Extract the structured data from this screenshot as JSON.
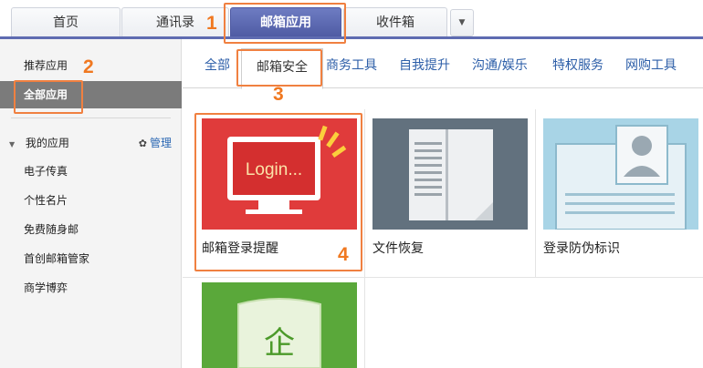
{
  "top_tabs": [
    {
      "label": "首页"
    },
    {
      "label": "通讯录"
    },
    {
      "label": "邮箱应用"
    },
    {
      "label": "收件箱"
    }
  ],
  "top_tabs_dropdown_icon": "chevron-down-icon",
  "sidebar": {
    "items": [
      {
        "label": "推荐应用"
      },
      {
        "label": "全部应用"
      }
    ],
    "my_apps_label": "我的应用",
    "manage_label": "管理",
    "my_apps": [
      {
        "label": "电子传真"
      },
      {
        "label": "个性名片"
      },
      {
        "label": "免费随身邮"
      },
      {
        "label": "首创邮箱管家"
      },
      {
        "label": "商学博弈"
      }
    ]
  },
  "categories": [
    {
      "label": "全部"
    },
    {
      "label": "邮箱安全"
    },
    {
      "label": "商务工具"
    },
    {
      "label": "自我提升"
    },
    {
      "label": "沟通/娱乐"
    },
    {
      "label": "特权服务"
    },
    {
      "label": "网购工具"
    }
  ],
  "apps": [
    {
      "title": "邮箱登录提醒",
      "thumb_text": "Login...",
      "color": "#e03b3b"
    },
    {
      "title": "文件恢复",
      "color": "#62717e"
    },
    {
      "title": "登录防伪标识",
      "color": "#a8d4e6"
    },
    {
      "title": "",
      "thumb_text": "企",
      "color": "#5aa83a"
    }
  ],
  "annotations": [
    "1",
    "2",
    "3",
    "4"
  ],
  "colors": {
    "accent": "#5e6bb1",
    "annotation": "#f07820",
    "selected_sidebar": "#7b7b7b",
    "link": "#2c5ea8"
  }
}
